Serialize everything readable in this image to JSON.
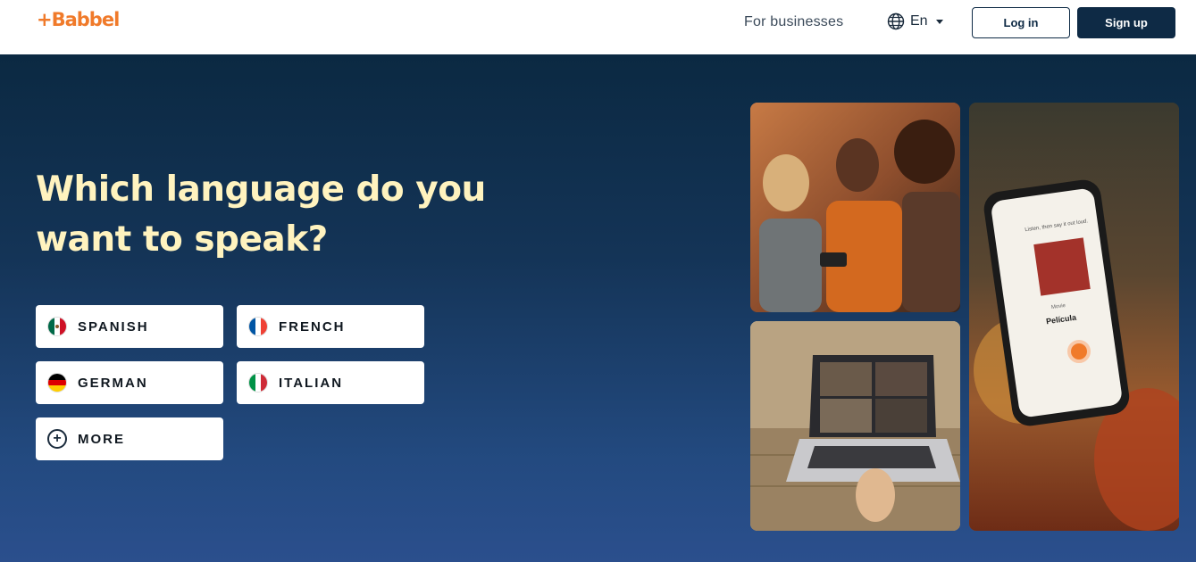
{
  "header": {
    "logo": "+Babbel",
    "for_businesses": "For businesses",
    "language": "En",
    "login": "Log in",
    "signup": "Sign up"
  },
  "hero": {
    "title": "Which language do you want to speak?",
    "languages": [
      {
        "label": "SPANISH",
        "icon": "mexico-flag-icon"
      },
      {
        "label": "FRENCH",
        "icon": "france-flag-icon"
      },
      {
        "label": "GERMAN",
        "icon": "germany-flag-icon"
      },
      {
        "label": "ITALIAN",
        "icon": "italy-flag-icon"
      },
      {
        "label": "MORE",
        "icon": "plus-circle-icon"
      }
    ]
  },
  "phone_screen": {
    "prompt": "Listen, then say it out loud.",
    "word_en": "Movie",
    "word_es": "Película"
  },
  "colors": {
    "brand_orange": "#f07a2a",
    "navy": "#0e2a45",
    "title_yellow": "#fff3bf"
  }
}
